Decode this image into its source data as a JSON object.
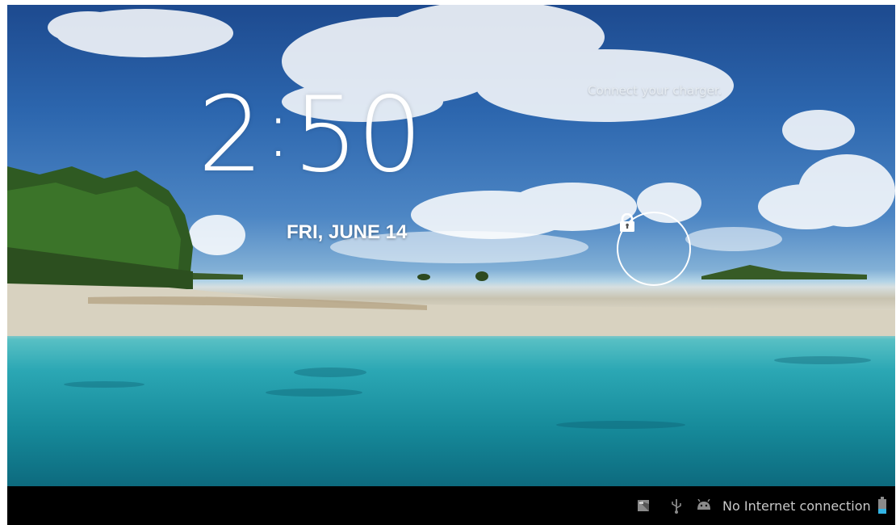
{
  "lockscreen": {
    "time_hour": "2",
    "time_separator": ":",
    "time_minutes": "50",
    "date": "FRI, JUNE 14",
    "charger_message": "Connect your charger."
  },
  "status_bar": {
    "network_status": "No Internet connection",
    "icons": [
      "screenshot-icon",
      "usb-icon",
      "android-debug-icon",
      "battery-icon"
    ]
  },
  "colors": {
    "status_bar_bg": "#000000",
    "battery_accent": "#33b5e5",
    "text_primary": "#ffffff"
  }
}
